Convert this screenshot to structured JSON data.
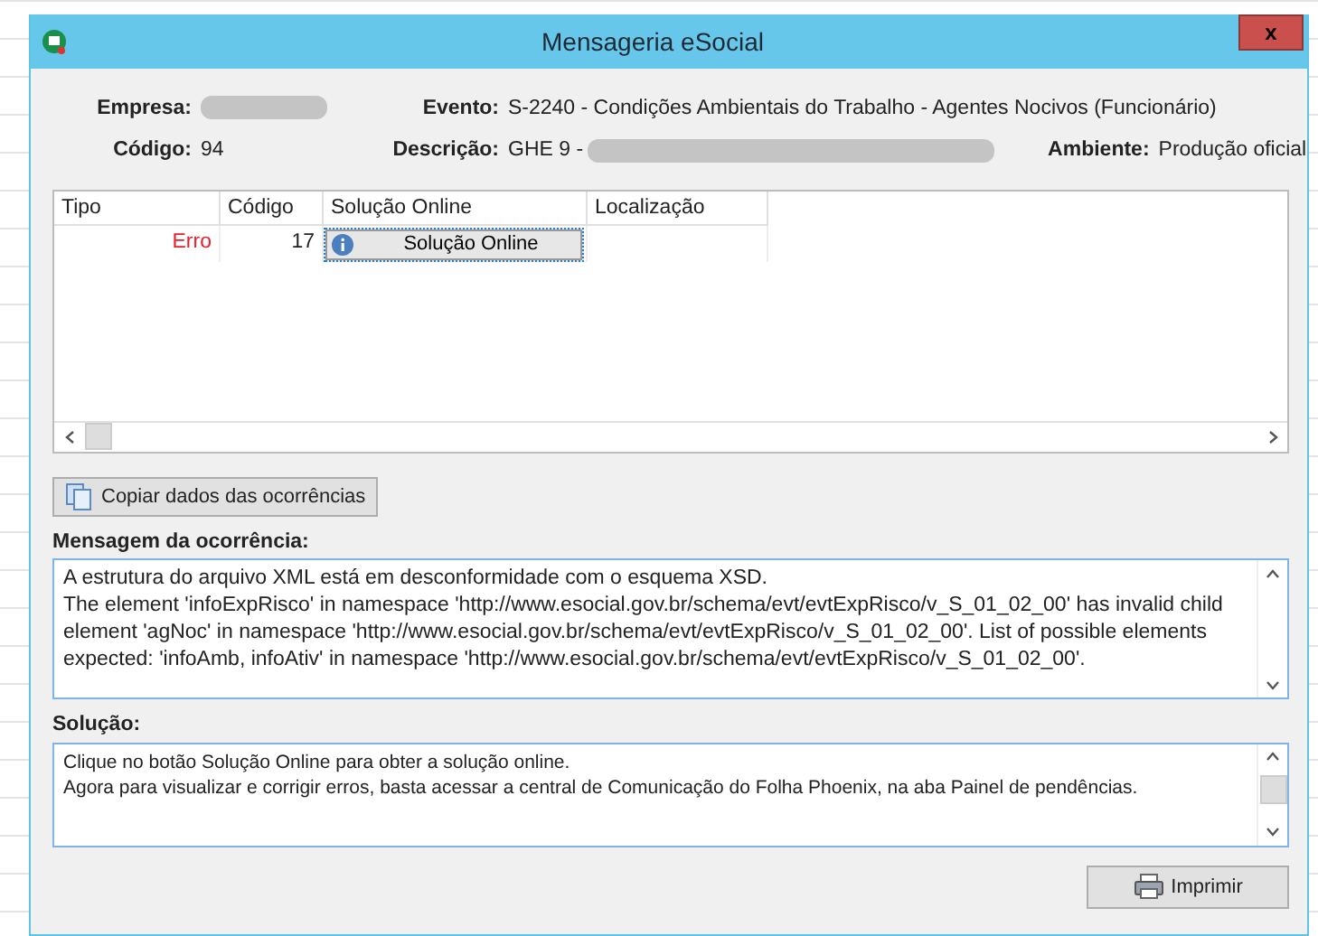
{
  "window": {
    "title": "Mensageria eSocial",
    "close_label": "x"
  },
  "header": {
    "empresa": {
      "label": "Empresa:",
      "redacted": true
    },
    "codigo": {
      "label": "Código:",
      "value": "94"
    },
    "evento": {
      "label": "Evento:",
      "value": "S-2240 - Condições Ambientais do Trabalho - Agentes Nocivos (Funcionário)"
    },
    "descricao": {
      "label": "Descrição:",
      "value": "GHE 9 -",
      "redacted": true
    },
    "ambiente": {
      "label": "Ambiente:",
      "value": "Produção oficial"
    }
  },
  "table": {
    "columns": [
      "Tipo",
      "Código",
      "Solução Online",
      "Localização"
    ],
    "rows": [
      {
        "tipo": "Erro",
        "color": "#e8202a",
        "codigo": "17",
        "solucao_button": "Solução Online",
        "selected": true
      }
    ]
  },
  "copy_button": "Copiar dados das ocorrências",
  "message": {
    "label": "Mensagem da ocorrência:",
    "paragraphs": [
      "A estrutura do arquivo XML está em desconformidade com o esquema XSD.",
      "The element 'infoExpRisco' in namespace 'http://www.esocial.gov.br/schema/evt/evtExpRisco/v_S_01_02_00' has invalid child element 'agNoc' in namespace 'http://www.esocial.gov.br/schema/evt/evtExpRisco/v_S_01_02_00'. List of possible elements expected: 'infoAmb, infoAtiv' in namespace 'http://www.esocial.gov.br/schema/evt/evtExpRisco/v_S_01_02_00'."
    ]
  },
  "solution": {
    "label": "Solução:",
    "paragraphs": [
      "Clique no botão Solução Online para obter a solução online.",
      "Agora para visualizar e corrigir erros, basta acessar a central de Comunicação do Folha Phoenix, na aba Painel de pendências."
    ]
  },
  "print_button": {
    "label": "Imprimir"
  }
}
